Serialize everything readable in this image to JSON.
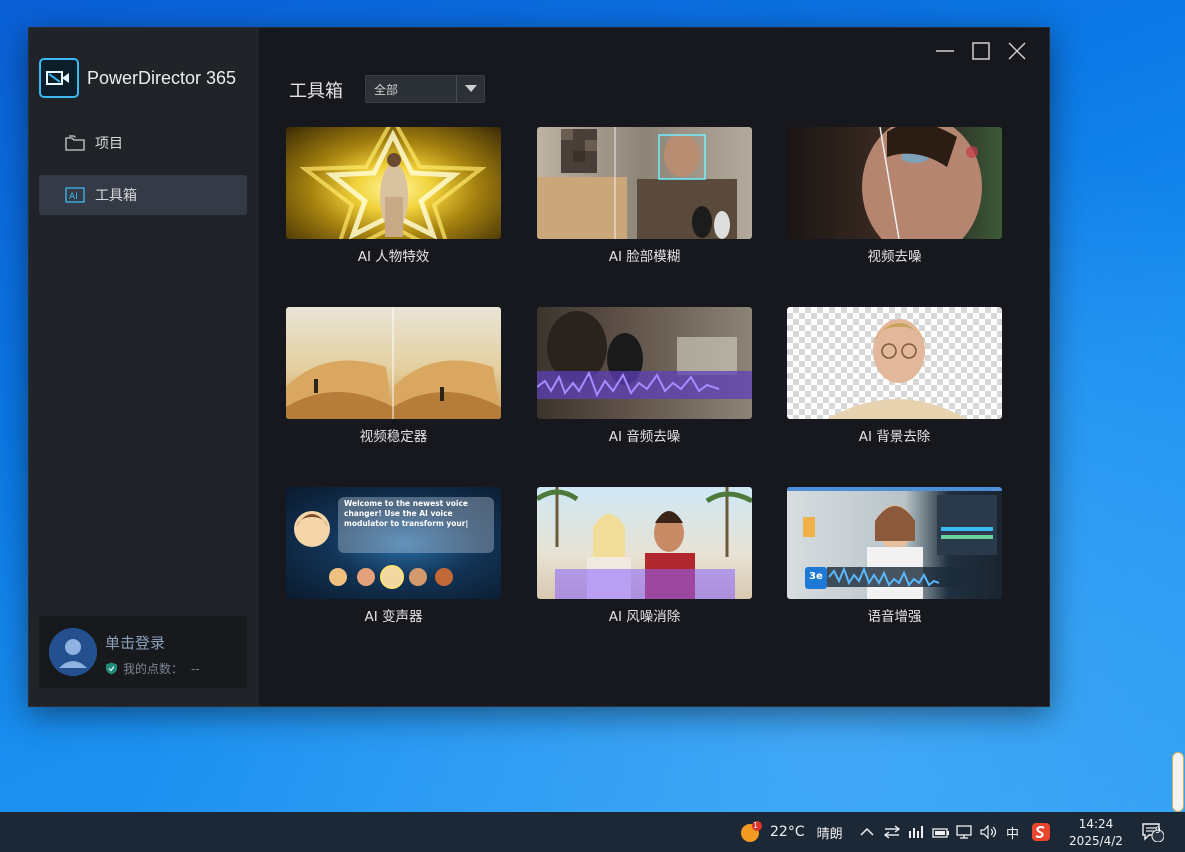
{
  "window": {
    "app_title": "PowerDirector 365",
    "controls": [
      "minimize-icon",
      "maximize-icon",
      "close-icon"
    ]
  },
  "sidebar": {
    "items": [
      {
        "label": "项目",
        "icon": "folder-icon",
        "active": false
      },
      {
        "label": "工具箱",
        "icon": "ai-toolbox-icon",
        "active": true
      }
    ],
    "login": {
      "label": "单击登录",
      "points_label": "我的点数：",
      "points_value": "--"
    }
  },
  "main": {
    "title": "工具箱",
    "filter": {
      "selected": "全部"
    },
    "tools": [
      {
        "label": "AI 人物特效"
      },
      {
        "label": "AI 脸部模糊"
      },
      {
        "label": "视频去噪"
      },
      {
        "label": "视频稳定器"
      },
      {
        "label": "AI 音频去噪"
      },
      {
        "label": "AI 背景去除"
      },
      {
        "label": "AI 变声器"
      },
      {
        "label": "AI 风噪消除"
      },
      {
        "label": "语音增强"
      }
    ],
    "voice_changer_bubble": "Welcome to the newest voice changer! Use the AI voice modulator to transform your|",
    "speech_badge": "3e"
  },
  "taskbar": {
    "weather_badge": "1",
    "temperature": "22°C",
    "weather": "晴朗",
    "ime": "中",
    "time": "14:24",
    "date": "2025/4/2",
    "notification_count": "9"
  },
  "colors": {
    "accent": "#3ab9f3",
    "window_bg": "#16181d",
    "sidebar_bg": "#202328",
    "active_item": "#353b46"
  }
}
